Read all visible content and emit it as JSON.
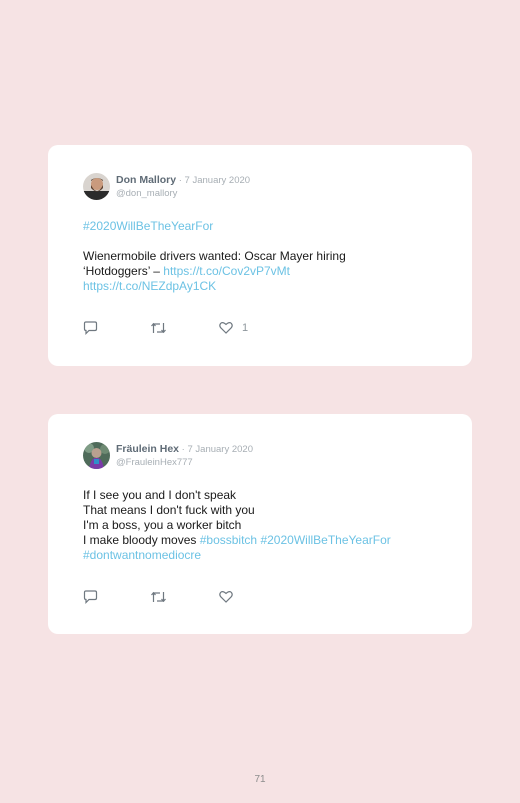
{
  "tweets": [
    {
      "name": "Don Mallory",
      "separator": " · ",
      "date": "7 January 2020",
      "handle": "@don_mallory",
      "hashtag_line": "#2020WillBeTheYearFor",
      "text_line_1": "Wienermobile drivers wanted: Oscar Mayer hiring",
      "text_line_2": "‘Hotdoggers’ –",
      "link_1": "https://t.co/Cov2vP7vMt",
      "link_2": "https://t.co/NEZdpAy1CK",
      "like_count": "1"
    },
    {
      "name": "Fräulein Hex",
      "separator": " · ",
      "date": "7 January 2020",
      "handle": "@FrauleinHex777",
      "line_1": "If I see you and I don't speak",
      "line_2": "That means I don't fuck with you",
      "line_3": "I'm a boss, you a worker bitch",
      "line_4_text": "I make bloody moves",
      "hashtag_1": "#bossbitch",
      "hashtag_2": "#2020WillBeTheYearFor",
      "hashtag_3": "#dontwantnomediocre"
    }
  ],
  "page_number": "71",
  "icons": [
    "reply-icon",
    "retweet-icon",
    "like-icon"
  ],
  "colors": {
    "background": "#f6e3e4",
    "card": "#ffffff",
    "link": "#6cc2e4",
    "meta": "#a7aeb4"
  }
}
